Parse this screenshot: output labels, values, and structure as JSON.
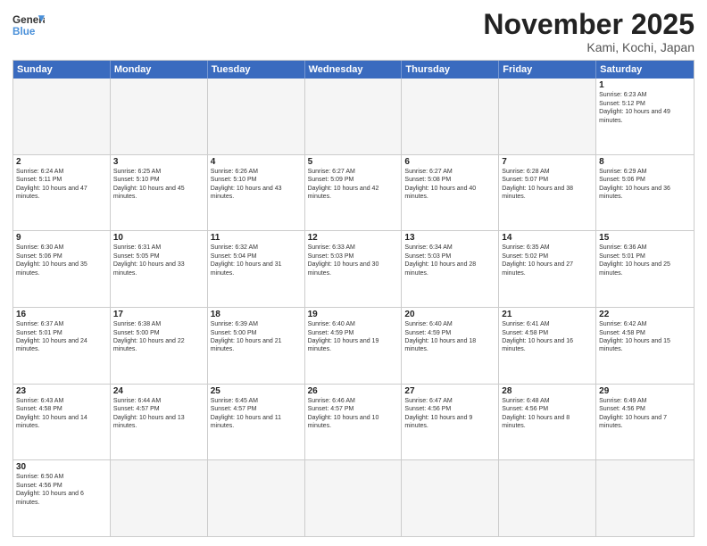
{
  "header": {
    "logo_general": "General",
    "logo_blue": "Blue",
    "month_title": "November 2025",
    "location": "Kami, Kochi, Japan"
  },
  "days_of_week": [
    "Sunday",
    "Monday",
    "Tuesday",
    "Wednesday",
    "Thursday",
    "Friday",
    "Saturday"
  ],
  "weeks": [
    [
      {
        "day": "",
        "empty": true
      },
      {
        "day": "",
        "empty": true
      },
      {
        "day": "",
        "empty": true
      },
      {
        "day": "",
        "empty": true
      },
      {
        "day": "",
        "empty": true
      },
      {
        "day": "",
        "empty": true
      },
      {
        "day": "1",
        "sunrise": "6:23 AM",
        "sunset": "5:12 PM",
        "daylight": "10 hours and 49 minutes."
      }
    ],
    [
      {
        "day": "2",
        "sunrise": "6:24 AM",
        "sunset": "5:11 PM",
        "daylight": "10 hours and 47 minutes."
      },
      {
        "day": "3",
        "sunrise": "6:25 AM",
        "sunset": "5:10 PM",
        "daylight": "10 hours and 45 minutes."
      },
      {
        "day": "4",
        "sunrise": "6:26 AM",
        "sunset": "5:10 PM",
        "daylight": "10 hours and 43 minutes."
      },
      {
        "day": "5",
        "sunrise": "6:27 AM",
        "sunset": "5:09 PM",
        "daylight": "10 hours and 42 minutes."
      },
      {
        "day": "6",
        "sunrise": "6:27 AM",
        "sunset": "5:08 PM",
        "daylight": "10 hours and 40 minutes."
      },
      {
        "day": "7",
        "sunrise": "6:28 AM",
        "sunset": "5:07 PM",
        "daylight": "10 hours and 38 minutes."
      },
      {
        "day": "8",
        "sunrise": "6:29 AM",
        "sunset": "5:06 PM",
        "daylight": "10 hours and 36 minutes."
      }
    ],
    [
      {
        "day": "9",
        "sunrise": "6:30 AM",
        "sunset": "5:06 PM",
        "daylight": "10 hours and 35 minutes."
      },
      {
        "day": "10",
        "sunrise": "6:31 AM",
        "sunset": "5:05 PM",
        "daylight": "10 hours and 33 minutes."
      },
      {
        "day": "11",
        "sunrise": "6:32 AM",
        "sunset": "5:04 PM",
        "daylight": "10 hours and 31 minutes."
      },
      {
        "day": "12",
        "sunrise": "6:33 AM",
        "sunset": "5:03 PM",
        "daylight": "10 hours and 30 minutes."
      },
      {
        "day": "13",
        "sunrise": "6:34 AM",
        "sunset": "5:03 PM",
        "daylight": "10 hours and 28 minutes."
      },
      {
        "day": "14",
        "sunrise": "6:35 AM",
        "sunset": "5:02 PM",
        "daylight": "10 hours and 27 minutes."
      },
      {
        "day": "15",
        "sunrise": "6:36 AM",
        "sunset": "5:01 PM",
        "daylight": "10 hours and 25 minutes."
      }
    ],
    [
      {
        "day": "16",
        "sunrise": "6:37 AM",
        "sunset": "5:01 PM",
        "daylight": "10 hours and 24 minutes."
      },
      {
        "day": "17",
        "sunrise": "6:38 AM",
        "sunset": "5:00 PM",
        "daylight": "10 hours and 22 minutes."
      },
      {
        "day": "18",
        "sunrise": "6:39 AM",
        "sunset": "5:00 PM",
        "daylight": "10 hours and 21 minutes."
      },
      {
        "day": "19",
        "sunrise": "6:40 AM",
        "sunset": "4:59 PM",
        "daylight": "10 hours and 19 minutes."
      },
      {
        "day": "20",
        "sunrise": "6:40 AM",
        "sunset": "4:59 PM",
        "daylight": "10 hours and 18 minutes."
      },
      {
        "day": "21",
        "sunrise": "6:41 AM",
        "sunset": "4:58 PM",
        "daylight": "10 hours and 16 minutes."
      },
      {
        "day": "22",
        "sunrise": "6:42 AM",
        "sunset": "4:58 PM",
        "daylight": "10 hours and 15 minutes."
      }
    ],
    [
      {
        "day": "23",
        "sunrise": "6:43 AM",
        "sunset": "4:58 PM",
        "daylight": "10 hours and 14 minutes."
      },
      {
        "day": "24",
        "sunrise": "6:44 AM",
        "sunset": "4:57 PM",
        "daylight": "10 hours and 13 minutes."
      },
      {
        "day": "25",
        "sunrise": "6:45 AM",
        "sunset": "4:57 PM",
        "daylight": "10 hours and 11 minutes."
      },
      {
        "day": "26",
        "sunrise": "6:46 AM",
        "sunset": "4:57 PM",
        "daylight": "10 hours and 10 minutes."
      },
      {
        "day": "27",
        "sunrise": "6:47 AM",
        "sunset": "4:56 PM",
        "daylight": "10 hours and 9 minutes."
      },
      {
        "day": "28",
        "sunrise": "6:48 AM",
        "sunset": "4:56 PM",
        "daylight": "10 hours and 8 minutes."
      },
      {
        "day": "29",
        "sunrise": "6:49 AM",
        "sunset": "4:56 PM",
        "daylight": "10 hours and 7 minutes."
      }
    ],
    [
      {
        "day": "30",
        "sunrise": "6:50 AM",
        "sunset": "4:56 PM",
        "daylight": "10 hours and 6 minutes."
      },
      {
        "day": "",
        "empty": true
      },
      {
        "day": "",
        "empty": true
      },
      {
        "day": "",
        "empty": true
      },
      {
        "day": "",
        "empty": true
      },
      {
        "day": "",
        "empty": true
      },
      {
        "day": "",
        "empty": true
      }
    ]
  ]
}
